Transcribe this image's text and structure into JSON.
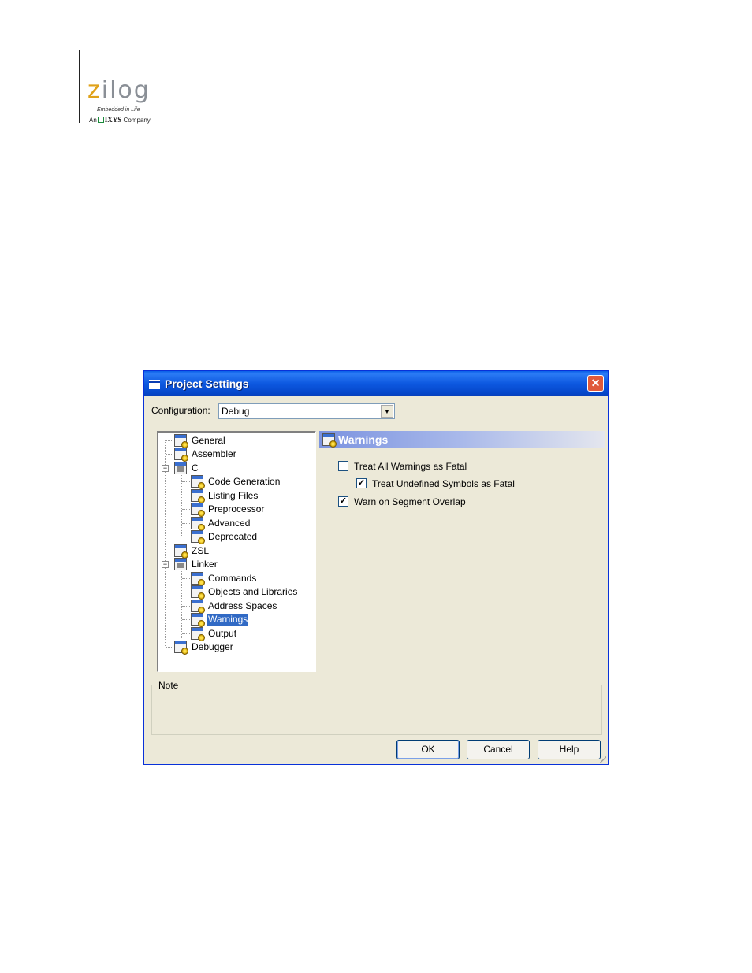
{
  "logo": {
    "word": "zilog",
    "tagline": "Embedded in Life",
    "sub_prefix": "An",
    "sub_brand": "IXYS",
    "sub_suffix": "Company"
  },
  "dialog": {
    "title": "Project Settings",
    "close_label": "✕",
    "configuration_label": "Configuration:",
    "configuration_value": "Debug",
    "tree": [
      {
        "label": "General",
        "level": 0
      },
      {
        "label": "Assembler",
        "level": 0
      },
      {
        "label": "C",
        "level": 0,
        "expander": "−"
      },
      {
        "label": "Code Generation",
        "level": 1
      },
      {
        "label": "Listing Files",
        "level": 1
      },
      {
        "label": "Preprocessor",
        "level": 1
      },
      {
        "label": "Advanced",
        "level": 1
      },
      {
        "label": "Deprecated",
        "level": 1
      },
      {
        "label": "ZSL",
        "level": 0
      },
      {
        "label": "Linker",
        "level": 0,
        "expander": "−"
      },
      {
        "label": "Commands",
        "level": 1
      },
      {
        "label": "Objects and Libraries",
        "level": 1
      },
      {
        "label": "Address Spaces",
        "level": 1
      },
      {
        "label": "Warnings",
        "level": 1,
        "selected": true
      },
      {
        "label": "Output",
        "level": 1
      },
      {
        "label": "Debugger",
        "level": 0
      }
    ],
    "panel_title": "Warnings",
    "options": [
      {
        "label": "Treat All Warnings as Fatal",
        "checked": false
      },
      {
        "label": "Treat Undefined Symbols as Fatal",
        "checked": true
      },
      {
        "label": "Warn on Segment Overlap",
        "checked": true
      }
    ],
    "note_label": "Note",
    "buttons": {
      "ok": "OK",
      "cancel": "Cancel",
      "help": "Help"
    }
  },
  "colors": {
    "title_bar": "#0a5fe8",
    "selection": "#316ac5",
    "dialog_bg": "#ece9d8",
    "close_button": "#e05a3b"
  }
}
